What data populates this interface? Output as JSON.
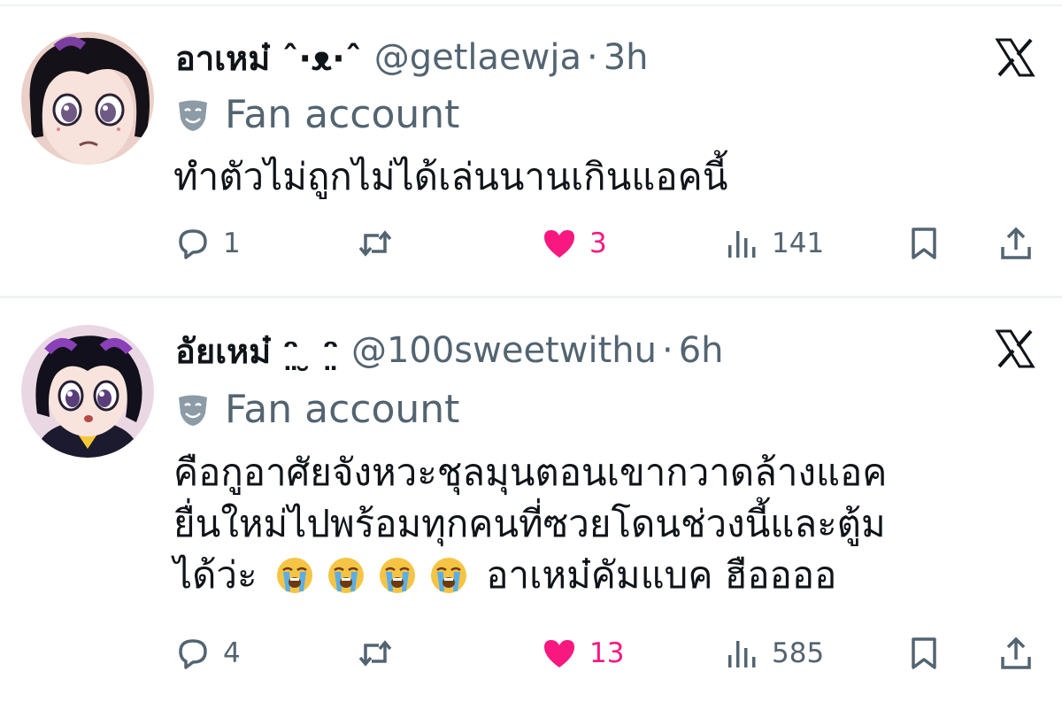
{
  "tweets": [
    {
      "display_name": "อาเหม๋ ˆ·ᴥ·ˆ",
      "handle": "@getlaewja",
      "separator": "·",
      "time": "3h",
      "label": "Fan account",
      "text": "ทำตัวไม่ถูกไม่ได้เล่นนานเกินแอคนี้",
      "replies": "1",
      "likes": "3",
      "views": "141",
      "liked": true
    },
    {
      "display_name": "อัยเหม๋ ᵔ̤ ̮ ᵔ̤",
      "handle": "@100sweetwithu",
      "separator": "·",
      "time": "6h",
      "label": "Fan account",
      "text_line1": "คือกูอาศัยจังหวะชุลมุนตอนเขากวาดล้างแอค",
      "text_line2": "ยื่นใหม่ไปพร้อมทุกคนที่ซวยโดนช่วงนี้และตู้ม",
      "text_line3_start": "ได้ว่ะ",
      "text_line3_end": "อาเหม๋คัมแบค ฮืออออ",
      "emoji": [
        "loudly-crying-face",
        "loudly-crying-face",
        "loudly-crying-face",
        "loudly-crying-face"
      ],
      "replies": "4",
      "likes": "13",
      "views": "585",
      "liked": true
    }
  ],
  "colors": {
    "text": "#0f1419",
    "secondary": "#536471",
    "like": "#f91880",
    "separator": "#eff3f4"
  },
  "icons": [
    "x-logo-icon",
    "theater-mask-icon",
    "reply-icon",
    "retweet-icon",
    "heart-icon",
    "views-icon",
    "bookmark-icon",
    "share-icon"
  ]
}
